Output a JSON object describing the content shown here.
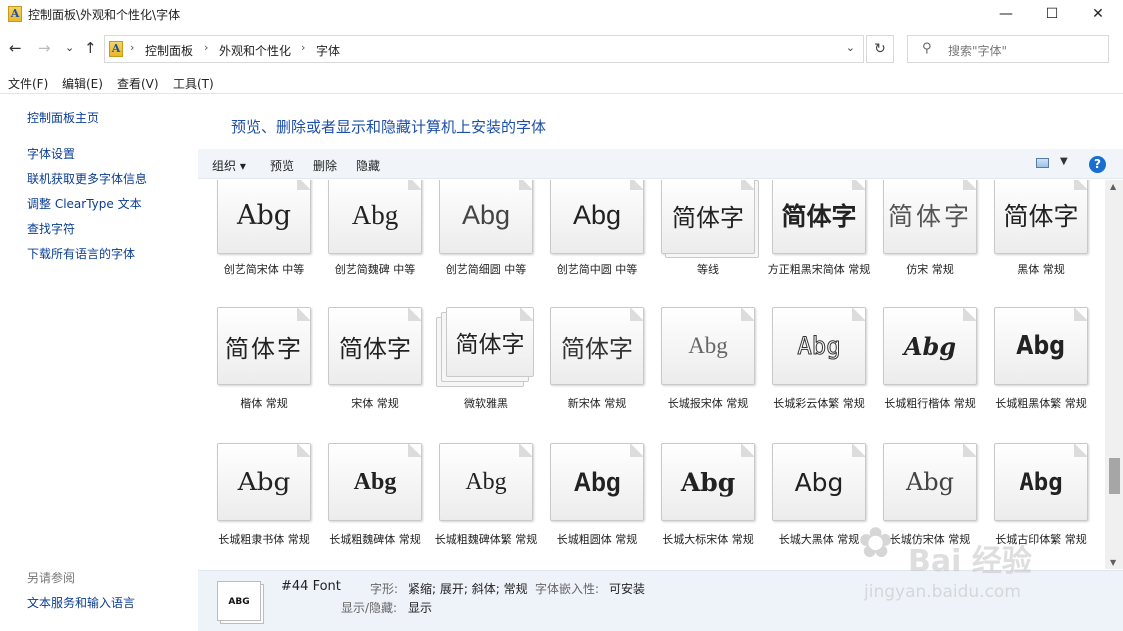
{
  "window": {
    "title": "控制面板\\外观和个性化\\字体",
    "app_icon_glyph": "A",
    "minimize": "—",
    "maximize": "☐",
    "close": "✕"
  },
  "nav": {
    "back": "←",
    "forward": "→",
    "recent": "⌄",
    "up": "↑",
    "breadcrumbs": [
      "控制面板",
      "外观和个性化",
      "字体"
    ],
    "refresh": "↻",
    "search_placeholder": "搜索\"字体\""
  },
  "menu": [
    "文件(F)",
    "编辑(E)",
    "查看(V)",
    "工具(T)"
  ],
  "left_pane": {
    "home": "控制面板主页",
    "links": [
      "字体设置",
      "联机获取更多字体信息",
      "调整 ClearType 文本",
      "查找字符",
      "下载所有语言的字体"
    ],
    "see_also_title": "另请参阅",
    "see_also": [
      "文本服务和输入语言"
    ]
  },
  "heading": "预览、删除或者显示和隐藏计算机上安装的字体",
  "toolbar": {
    "organize": "组织 ▾",
    "preview": "预览",
    "delete": "删除",
    "hide": "隐藏",
    "help": "?"
  },
  "fonts": [
    {
      "sample": "Abg",
      "name": "创艺简宋体 中等"
    },
    {
      "sample": "Abg",
      "name": "创艺简魏碑 中等"
    },
    {
      "sample": "Abg",
      "name": "创艺简细圆 中等"
    },
    {
      "sample": "Abg",
      "name": "创艺简中圆 中等"
    },
    {
      "sample": "简体字",
      "name": "等线"
    },
    {
      "sample": "简体字",
      "name": "方正粗黑宋简体 常规"
    },
    {
      "sample": "简体字",
      "name": "仿宋 常规"
    },
    {
      "sample": "简体字",
      "name": "黑体 常规"
    },
    {
      "sample": "简体字",
      "name": "楷体 常规"
    },
    {
      "sample": "简体字",
      "name": "宋体 常规"
    },
    {
      "sample": "简体字",
      "name": "微软雅黑"
    },
    {
      "sample": "简体字",
      "name": "新宋体 常规"
    },
    {
      "sample": "Abg",
      "name": "长城报宋体 常规"
    },
    {
      "sample": "Abg",
      "name": "长城彩云体繁 常规"
    },
    {
      "sample": "Abg",
      "name": "长城粗行楷体 常规"
    },
    {
      "sample": "Abg",
      "name": "长城粗黑体繁 常规"
    },
    {
      "sample": "Abg",
      "name": "长城粗隶书体 常规"
    },
    {
      "sample": "Abg",
      "name": "长城粗魏碑体 常规"
    },
    {
      "sample": "Abg",
      "name": "长城粗魏碑体繁 常规"
    },
    {
      "sample": "Abg",
      "name": "长城粗圆体 常规"
    },
    {
      "sample": "Abg",
      "name": "长城大标宋体 常规"
    },
    {
      "sample": "Abg",
      "name": "长城大黑体 常规"
    },
    {
      "sample": "Abg",
      "name": "长城仿宋体 常规"
    },
    {
      "sample": "Abg",
      "name": "长城古印体繁 常规"
    }
  ],
  "details": {
    "thumb": "ABG",
    "name": "#44 Font",
    "style_label": "字形:",
    "style_value": "紧缩; 展开; 斜体; 常规",
    "embed_label": "字体嵌入性:",
    "embed_value": "可安装",
    "visibility_label": "显示/隐藏:",
    "visibility_value": "显示"
  },
  "watermark": {
    "text": "Bai 经验",
    "url": "jingyan.baidu.com"
  }
}
